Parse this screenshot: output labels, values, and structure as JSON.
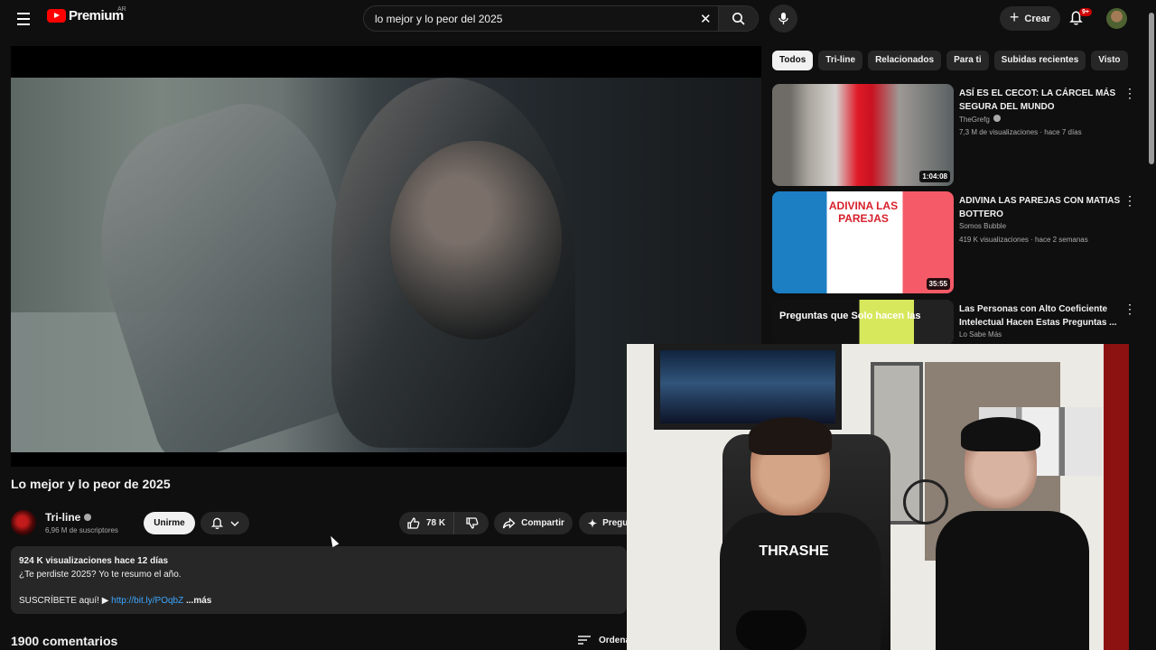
{
  "header": {
    "logo_text": "Premium",
    "country": "AR",
    "search_value": "lo mejor y lo peor del 2025",
    "create_label": "Crear",
    "notification_badge": "9+"
  },
  "video": {
    "title": "Lo mejor y lo peor de 2025",
    "channel": "Tri-line",
    "subscribers": "6,96 M de suscriptores",
    "join_label": "Unirme",
    "likes": "78 K",
    "share_label": "Compartir",
    "ask_label": "Pregu",
    "description": {
      "stats": "924 K visualizaciones  hace 12 días",
      "line1": "¿Te perdiste 2025? Yo te resumo el año.",
      "line2_prefix": "SUSCRÍBETE aquí! ▶",
      "link": "http://bit.ly/POqbZ",
      "more": "...más"
    },
    "comments": "1900 comentarios",
    "sort_label": "Ordena"
  },
  "chips": [
    "Todos",
    "Tri-line",
    "Relacionados",
    "Para ti",
    "Subidas recientes",
    "Visto"
  ],
  "recommendations": [
    {
      "title": "ASÍ ES EL CECOT: LA CÁRCEL MÁS SEGURA DEL MUNDO",
      "channel": "TheGrefg",
      "meta": "7,3 M de visualizaciones · hace 7 días",
      "duration": "1:04:08"
    },
    {
      "title": "ADIVINA LAS PAREJAS CON MATIAS BOTTERO",
      "channel": "Somos Bubble",
      "meta": "419 K visualizaciones · hace 2 semanas",
      "duration": "35:55",
      "thumb_text": "ADIVINA LAS PAREJAS"
    },
    {
      "title": "Las Personas con Alto Coeficiente Intelectual Hacen Estas Preguntas ...",
      "channel": "Lo Sabe Más",
      "meta": "",
      "duration": "",
      "thumb_text": "Preguntas que Solo hacen las"
    }
  ],
  "webcam": {
    "shirt_text": "THRASHE"
  },
  "colors": {
    "background": "#0f0f0f",
    "surface": "#272727",
    "accent": "#ff0000",
    "link": "#3ea6ff"
  }
}
